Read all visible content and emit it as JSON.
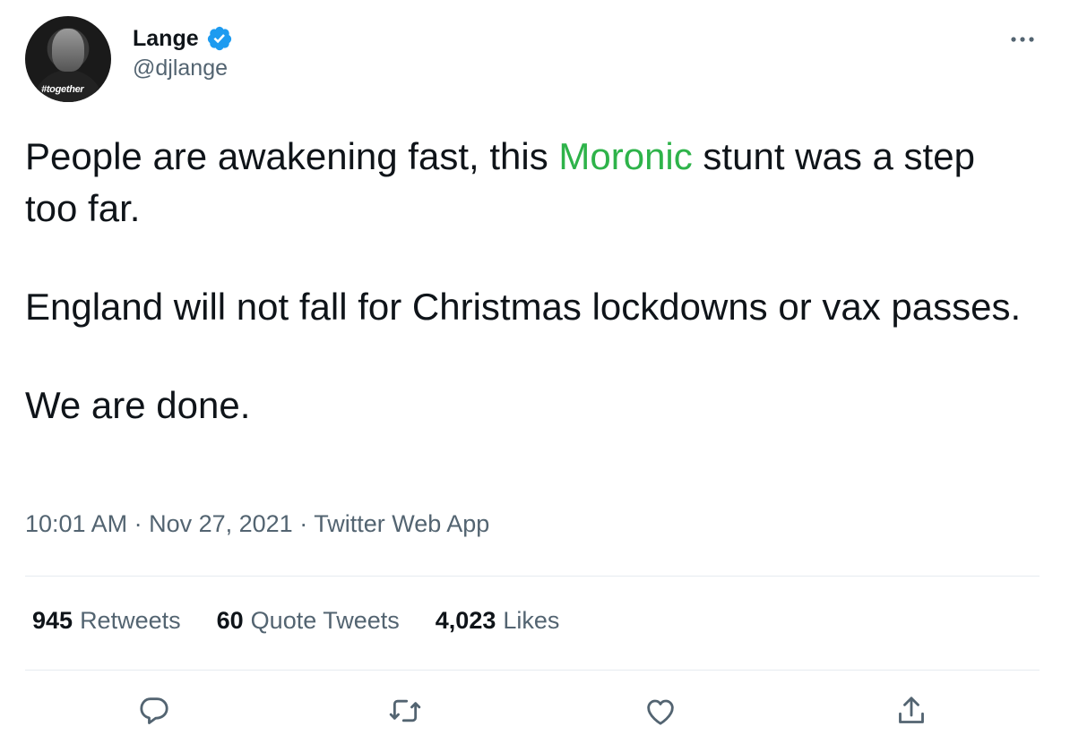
{
  "colors": {
    "accent": "#1d9bf0",
    "highlight": "#2eb34a",
    "muted": "#536471"
  },
  "user": {
    "display_name": "Lange",
    "handle": "@djlange",
    "avatar_tag": "#together",
    "verified_icon": "verified-badge-icon"
  },
  "tweet": {
    "line1_before": "People are awakening fast, this ",
    "line1_highlight": "Moronic",
    "line1_after": " stunt was a step too far.",
    "para2": "England will not fall for Christmas lockdowns or vax passes.",
    "para3": "We are done."
  },
  "meta": {
    "text": "10:01 AM · Nov 27, 2021 · Twitter Web App"
  },
  "stats": {
    "retweets_count": "945",
    "retweets_label": "Retweets",
    "quotes_count": "60",
    "quotes_label": "Quote Tweets",
    "likes_count": "4,023",
    "likes_label": "Likes"
  },
  "actions": [
    "reply-icon",
    "retweet-icon",
    "like-icon",
    "share-icon"
  ]
}
